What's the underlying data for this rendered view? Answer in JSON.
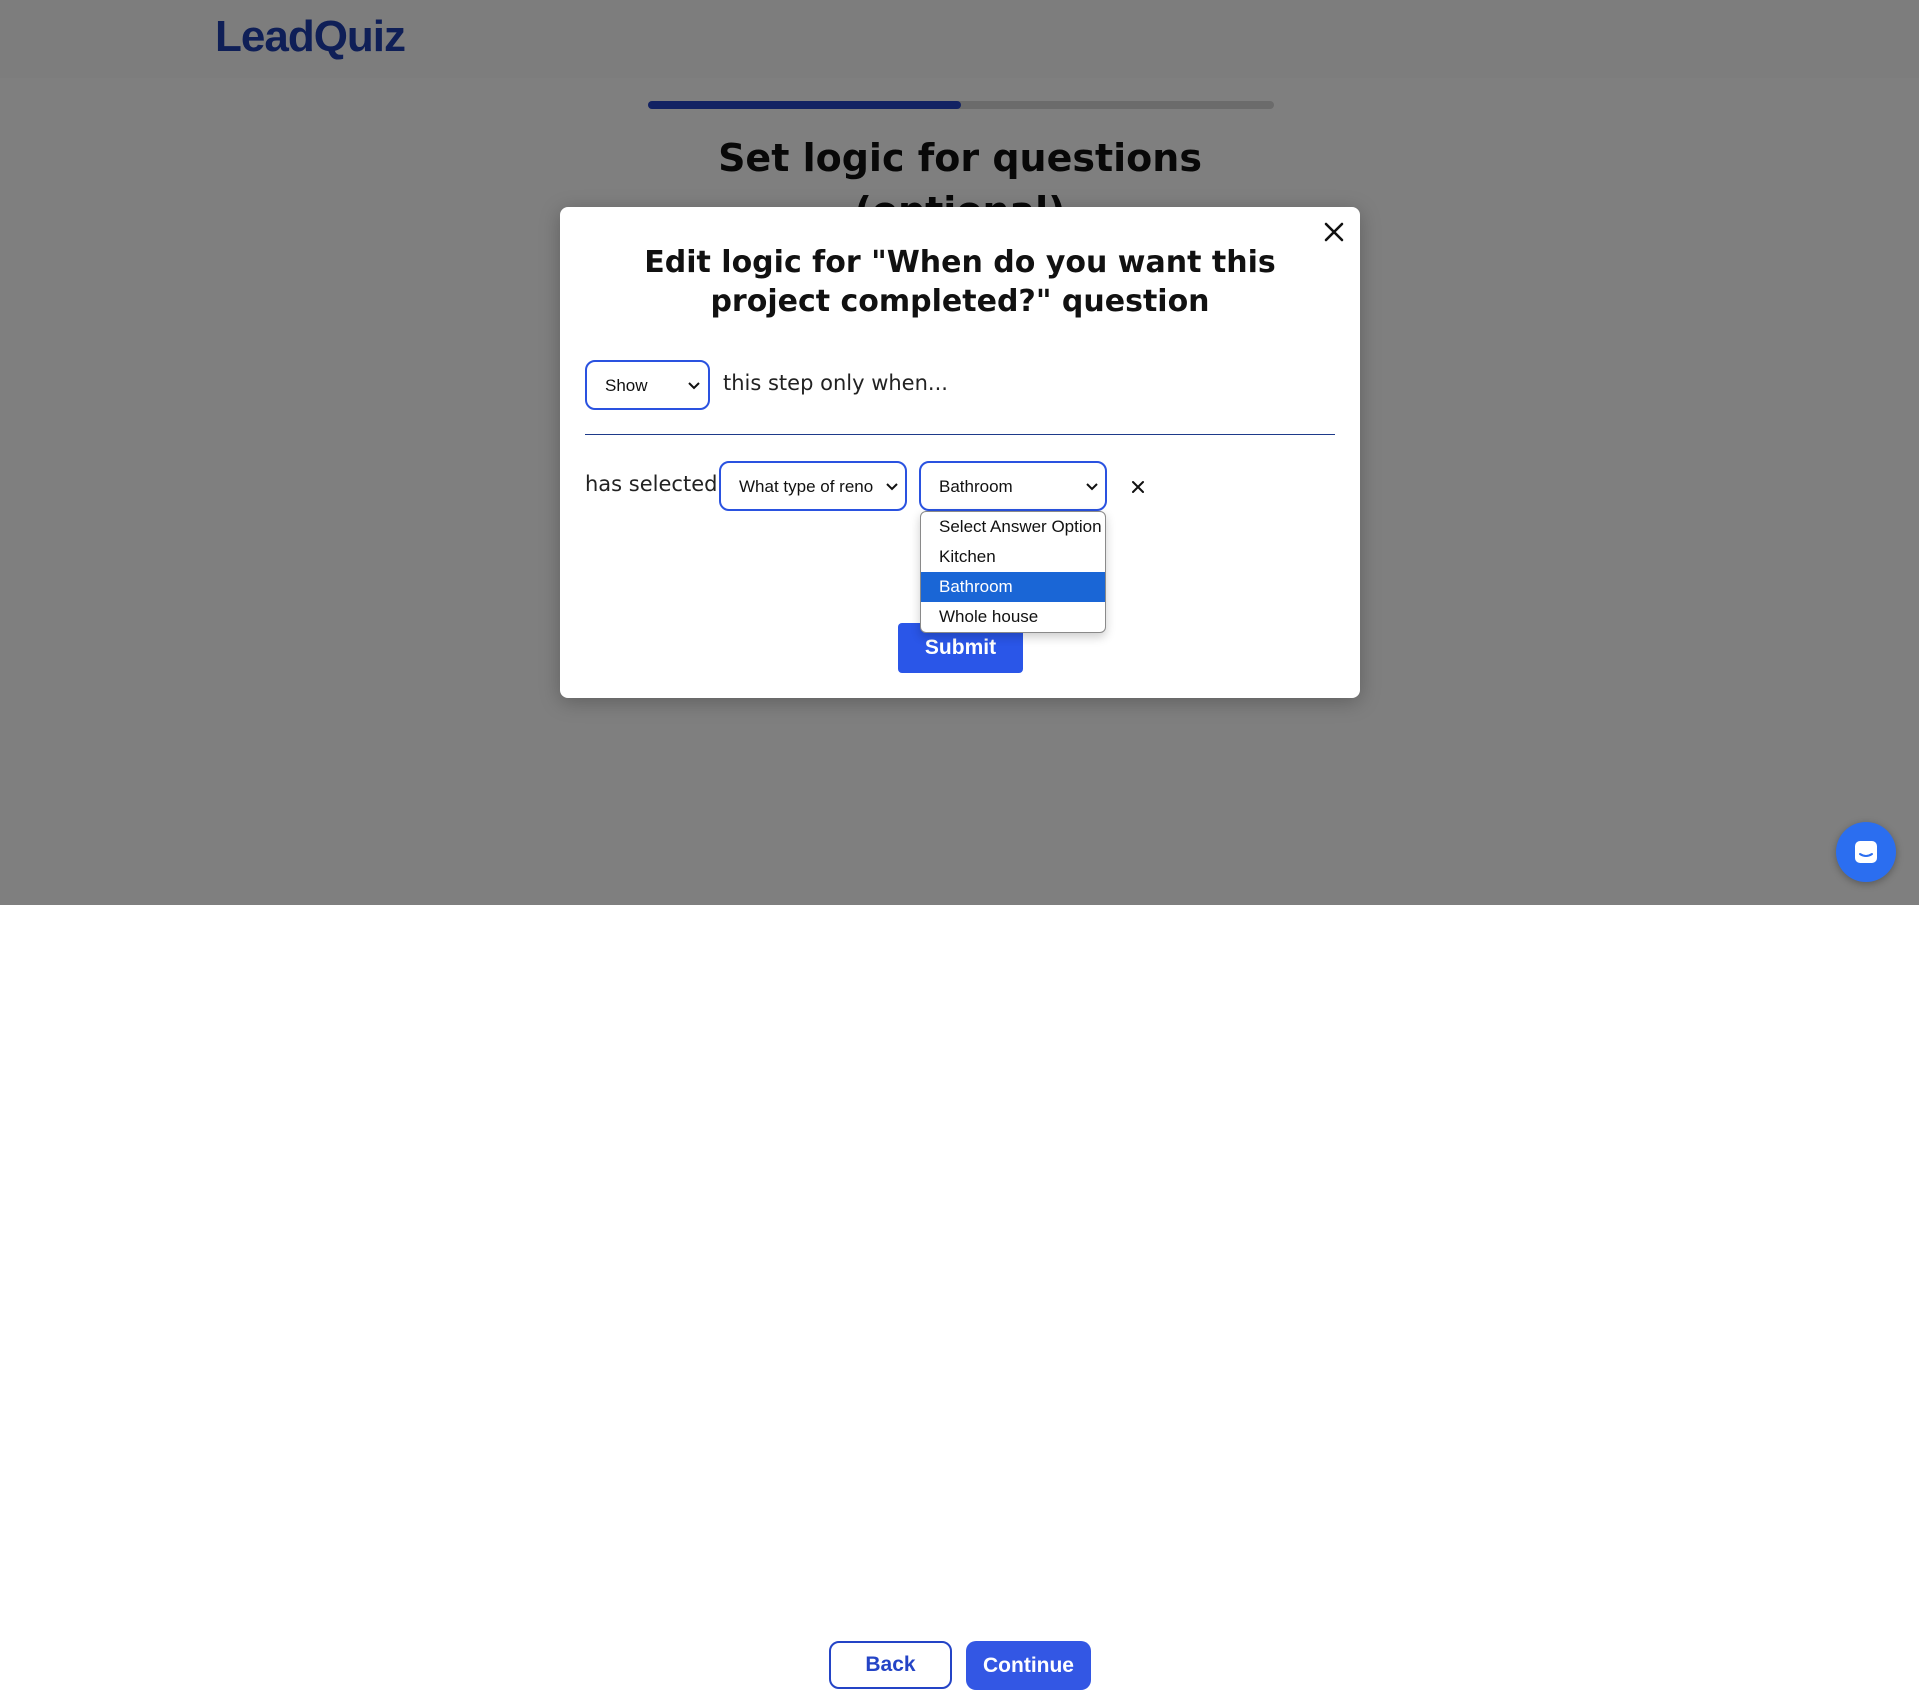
{
  "brand": {
    "logo_text": "LeadQuiz",
    "color": "#1f3fae"
  },
  "progress": {
    "value_percent": 50
  },
  "page": {
    "title": "Set logic for questions (optional)"
  },
  "footer": {
    "back_label": "Back",
    "continue_label": "Continue"
  },
  "modal": {
    "title": "Edit logic for \"When do you want this project completed?\" question",
    "close_icon": "close-icon",
    "visibility_select": {
      "value": "Show",
      "options": [
        "Show"
      ]
    },
    "step_text": "this step only when...",
    "condition": {
      "label": "has selected:",
      "question_select": {
        "value": "What type of reno"
      },
      "answer_select": {
        "value": "Bathroom"
      },
      "remove_icon": "close-icon"
    },
    "answer_options": [
      {
        "label": "Select Answer Option",
        "selected": false
      },
      {
        "label": "Kitchen",
        "selected": false
      },
      {
        "label": "Bathroom",
        "selected": true
      },
      {
        "label": "Whole house",
        "selected": false
      }
    ],
    "submit_label": "Submit"
  },
  "chat_widget": {
    "icon": "chat-icon"
  },
  "colors": {
    "accent": "#2a52e0",
    "selected_option": "#1a66d6"
  }
}
